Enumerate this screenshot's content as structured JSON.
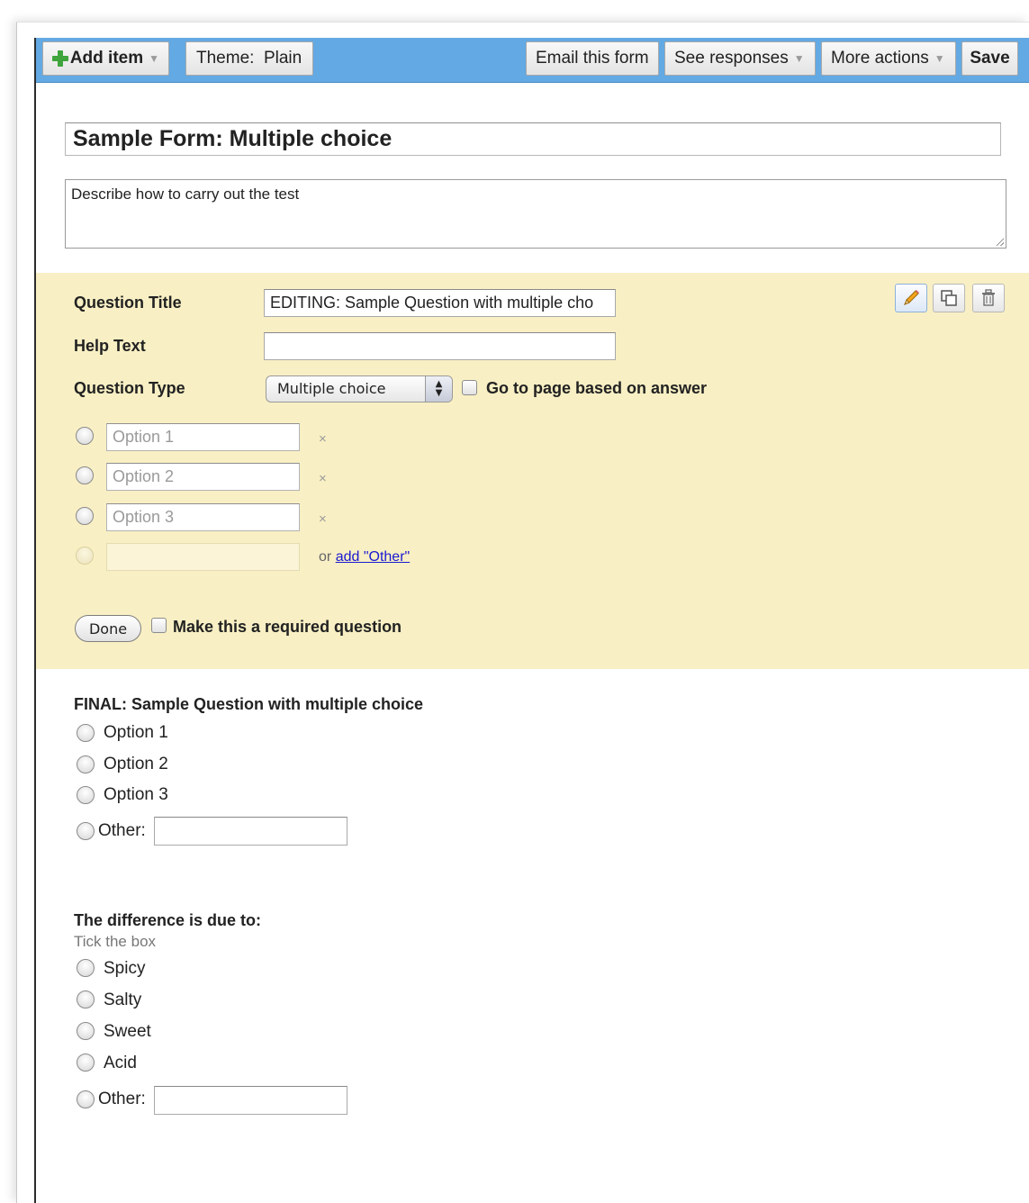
{
  "toolbar": {
    "add_item": "Add item",
    "theme": "Theme:  Plain",
    "email_form": "Email this form",
    "see_responses": "See responses",
    "more_actions": "More actions",
    "save": "Save"
  },
  "form": {
    "title": "Sample Form: Multiple choice",
    "description": "Describe how to carry out the test"
  },
  "editor": {
    "question_title_label": "Question Title",
    "question_title_value": "EDITING: Sample Question with multiple cho",
    "help_text_label": "Help Text",
    "help_text_value": "",
    "question_type_label": "Question Type",
    "question_type_value": "Multiple choice",
    "go_to_page_label": "Go to page based on answer",
    "options": [
      "Option 1",
      "Option 2",
      "Option 3"
    ],
    "remove_symbol": "×",
    "or_text": "or",
    "add_other_link": "add \"Other\"",
    "done_button": "Done",
    "required_label": "Make this a required question"
  },
  "question1": {
    "title": "FINAL: Sample Question with multiple choice",
    "options": [
      "Option 1",
      "Option 2",
      "Option 3"
    ],
    "other_label": "Other:"
  },
  "question2": {
    "title": "The difference is due to:",
    "help": "Tick the box",
    "options": [
      "Spicy",
      "Salty",
      "Sweet",
      "Acid"
    ],
    "other_label": "Other:"
  },
  "colors": {
    "toolbar_bg": "#63a9e3",
    "edit_panel_bg": "#f8efc4",
    "plus_icon": "#3ea43b",
    "link": "#1a1ad1"
  },
  "icons": [
    "plus-icon",
    "caret-down-icon",
    "pencil-icon",
    "duplicate-icon",
    "trash-icon",
    "resize-grip-icon",
    "select-arrows-icon"
  ]
}
